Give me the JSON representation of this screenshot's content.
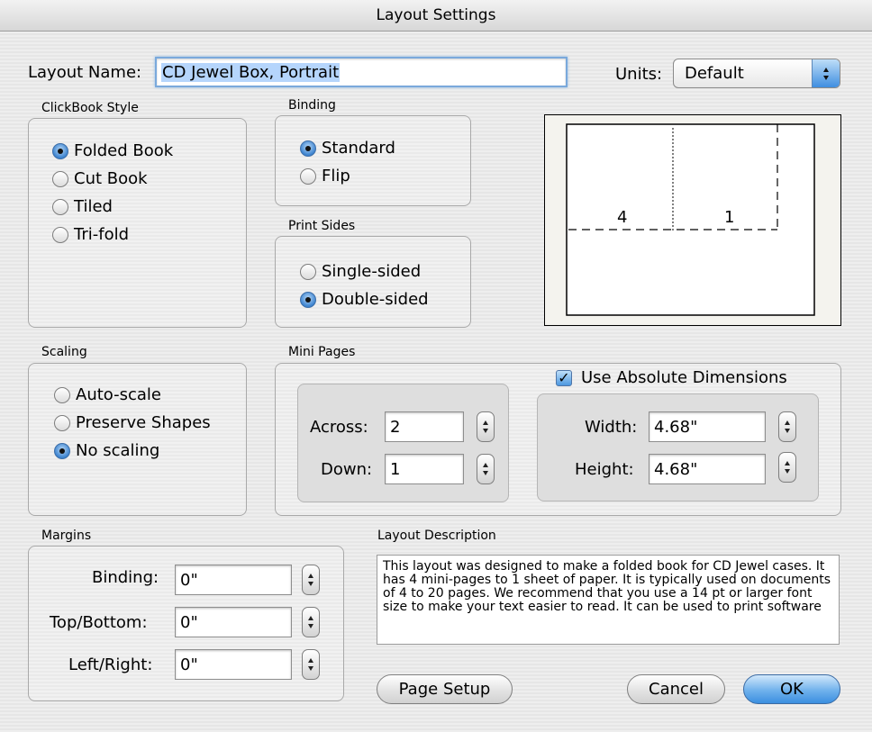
{
  "window": {
    "title": "Layout Settings"
  },
  "layout_name": {
    "label": "Layout Name:",
    "value": "CD Jewel Box, Portrait"
  },
  "units": {
    "label": "Units:",
    "value": "Default"
  },
  "clickbook_style": {
    "title": "ClickBook Style",
    "options": [
      "Folded Book",
      "Cut Book",
      "Tiled",
      "Tri-fold"
    ],
    "selected": "Folded Book"
  },
  "binding": {
    "title": "Binding",
    "options": [
      "Standard",
      "Flip"
    ],
    "selected": "Standard"
  },
  "print_sides": {
    "title": "Print Sides",
    "options": [
      "Single-sided",
      "Double-sided"
    ],
    "selected": "Double-sided"
  },
  "preview": {
    "page_left": "4",
    "page_right": "1"
  },
  "scaling": {
    "title": "Scaling",
    "options": [
      "Auto-scale",
      "Preserve Shapes",
      "No scaling"
    ],
    "selected": "No scaling"
  },
  "mini_pages": {
    "title": "Mini Pages",
    "across_label": "Across:",
    "across_value": "2",
    "down_label": "Down:",
    "down_value": "1",
    "use_absolute_label": "Use Absolute Dimensions",
    "use_absolute_checked": true,
    "width_label": "Width:",
    "width_value": "4.68\"",
    "height_label": "Height:",
    "height_value": "4.68\""
  },
  "margins": {
    "title": "Margins",
    "binding_label": "Binding:",
    "binding_value": "0\"",
    "topbottom_label": "Top/Bottom:",
    "topbottom_value": "0\"",
    "leftright_label": "Left/Right:",
    "leftright_value": "0\""
  },
  "layout_description": {
    "title": "Layout Description",
    "text": "This layout was designed to make a folded book for CD Jewel cases.  It has  4 mini-pages to 1 sheet of paper. It is typically used on documents of 4 to 20 pages.  We recommend that you use a 14 pt or larger font size to make your text easier to read.  It can be used to print software"
  },
  "buttons": {
    "page_setup": "Page Setup",
    "cancel": "Cancel",
    "ok": "OK"
  }
}
